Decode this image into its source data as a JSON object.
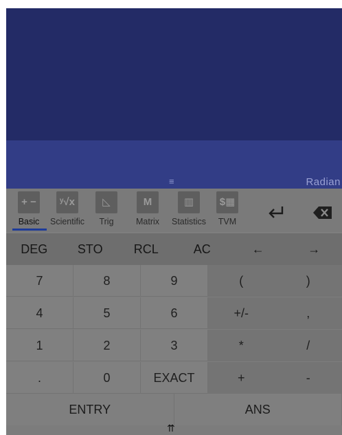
{
  "display": {
    "mode": "Radian",
    "handle_glyph": "≡"
  },
  "tabs": [
    {
      "label": "Basic",
      "icon_text": "+ −",
      "icon": "basic-ops-icon"
    },
    {
      "label": "Scientific",
      "icon_text": "ʸ√x",
      "icon": "root-icon"
    },
    {
      "label": "Trig",
      "icon_text": "◺",
      "icon": "triangle-icon"
    },
    {
      "label": "Matrix",
      "icon_text": "M",
      "icon": "matrix-icon"
    },
    {
      "label": "Statistics",
      "icon_text": "▥",
      "icon": "bar-chart-icon"
    },
    {
      "label": "TVM",
      "icon_text": "$▦",
      "icon": "money-calculator-icon"
    }
  ],
  "actions": {
    "enter_glyph": "↵",
    "backspace_glyph": "✕"
  },
  "fn_row": [
    "DEG",
    "STO",
    "RCL",
    "AC",
    "←",
    "→"
  ],
  "keypad": [
    [
      "7",
      "8",
      "9",
      "(",
      ")"
    ],
    [
      "4",
      "5",
      "6",
      "+/-",
      ","
    ],
    [
      "1",
      "2",
      "3",
      "*",
      "/"
    ],
    [
      ".",
      "0",
      "EXACT",
      "+",
      "-"
    ]
  ],
  "bottom_row": [
    "ENTRY",
    "ANS"
  ],
  "footer": {
    "glyph": "⇈"
  }
}
